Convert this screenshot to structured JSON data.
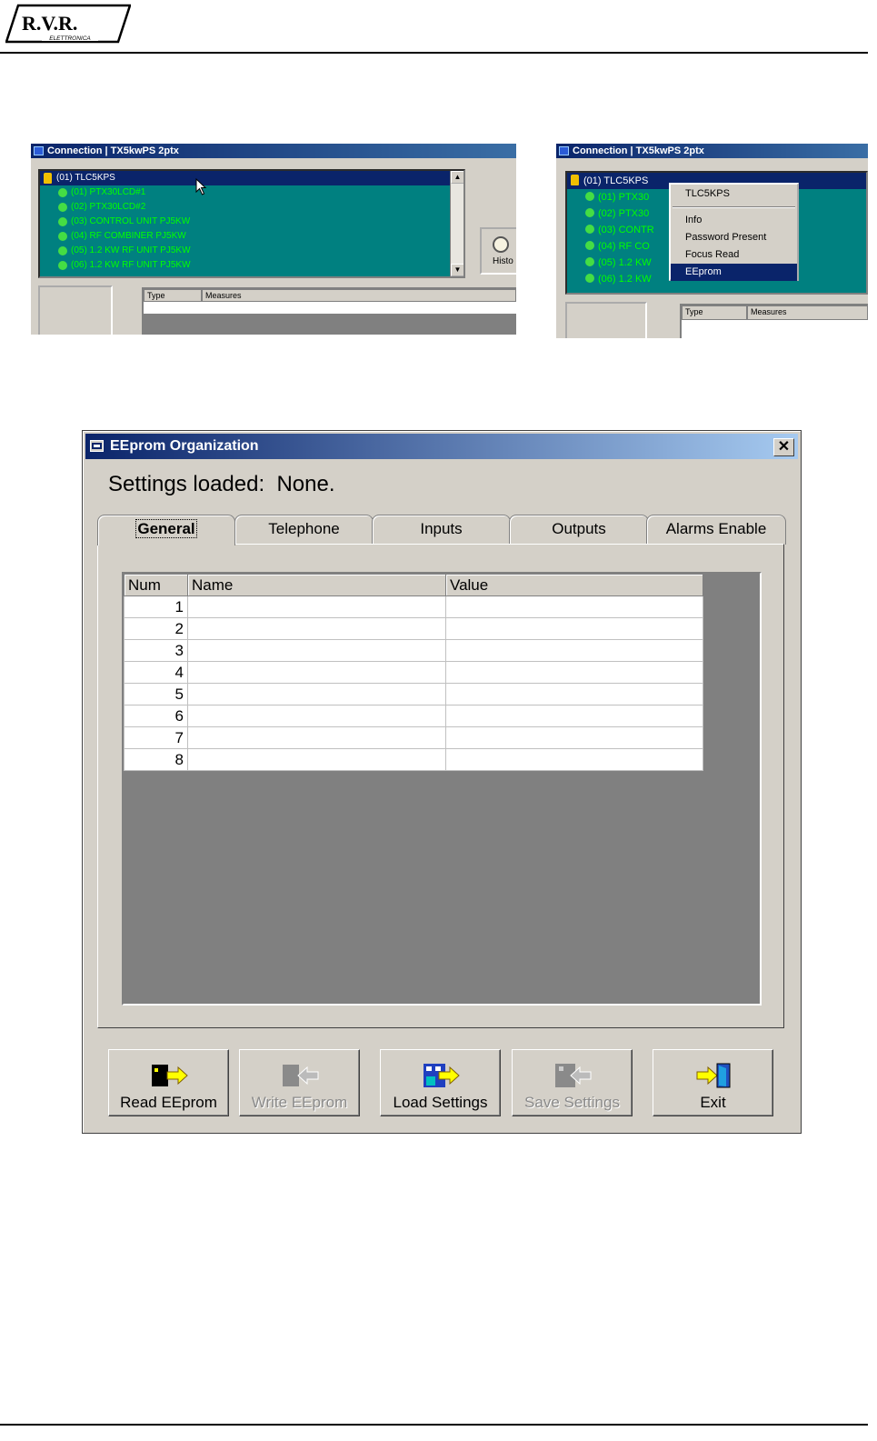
{
  "header": {
    "logo_text": "R.V.R.",
    "logo_subtext": "ELETTRONICA"
  },
  "screenshot_left": {
    "title": "Connection | TX5kwPS 2ptx",
    "tree": [
      {
        "label": "(01) TLC5KPS",
        "selected": true
      },
      {
        "label": "(01) PTX30LCD#1"
      },
      {
        "label": "(02) PTX30LCD#2"
      },
      {
        "label": "(03) CONTROL UNIT  PJ5KW"
      },
      {
        "label": "(04) RF COMBINER    PJ5KW"
      },
      {
        "label": "(05) 1.2 KW RF UNIT  PJ5KW"
      },
      {
        "label": "(06) 1.2 KW RF UNIT  PJ5KW"
      }
    ],
    "history_label": "Histo",
    "columns": [
      "Type",
      "Measures"
    ]
  },
  "screenshot_right": {
    "title": "Connection | TX5kwPS 2ptx",
    "tree": [
      {
        "label": "(01) TLC5KPS",
        "selected": true
      },
      {
        "label": "(01) PTX30"
      },
      {
        "label": "(02) PTX30"
      },
      {
        "label": "(03) CONTR"
      },
      {
        "label": "(04) RF CO"
      },
      {
        "label": "(05) 1.2 KW"
      },
      {
        "label": "(06) 1.2 KW"
      }
    ],
    "context_menu": {
      "header": "TLC5KPS",
      "items": [
        "Info",
        "Password Present",
        "Focus Read",
        "EEprom"
      ],
      "selected": "EEprom"
    },
    "columns": [
      "Type",
      "Measures"
    ]
  },
  "dialog": {
    "title": "EEprom Organization",
    "close_label": "✕",
    "settings_label": "Settings loaded:  None.",
    "tabs": [
      "General",
      "Telephone",
      "Inputs",
      "Outputs",
      "Alarms Enable"
    ],
    "active_tab": "General",
    "grid": {
      "columns": [
        "Num",
        "Name",
        "Value"
      ],
      "rows": [
        {
          "num": "1",
          "name": "",
          "value": ""
        },
        {
          "num": "2",
          "name": "",
          "value": ""
        },
        {
          "num": "3",
          "name": "",
          "value": ""
        },
        {
          "num": "4",
          "name": "",
          "value": ""
        },
        {
          "num": "5",
          "name": "",
          "value": ""
        },
        {
          "num": "6",
          "name": "",
          "value": ""
        },
        {
          "num": "7",
          "name": "",
          "value": ""
        },
        {
          "num": "8",
          "name": "",
          "value": ""
        }
      ]
    },
    "buttons": [
      {
        "label": "Read EEprom",
        "enabled": true,
        "icon": "read-eeprom-icon"
      },
      {
        "label": "Write EEprom",
        "enabled": false,
        "icon": "write-eeprom-icon"
      },
      {
        "label": "Load Settings",
        "enabled": true,
        "icon": "load-settings-icon"
      },
      {
        "label": "Save Settings",
        "enabled": false,
        "icon": "save-settings-icon"
      },
      {
        "label": "Exit",
        "enabled": true,
        "icon": "exit-door-icon"
      }
    ]
  },
  "colors": {
    "titlebar_start": "#0a246a",
    "titlebar_end": "#a6caf0",
    "tree_bg": "#008080",
    "tree_text": "#00ff00",
    "dialog_face": "#d4d0c8",
    "grid_bg": "#808080"
  }
}
